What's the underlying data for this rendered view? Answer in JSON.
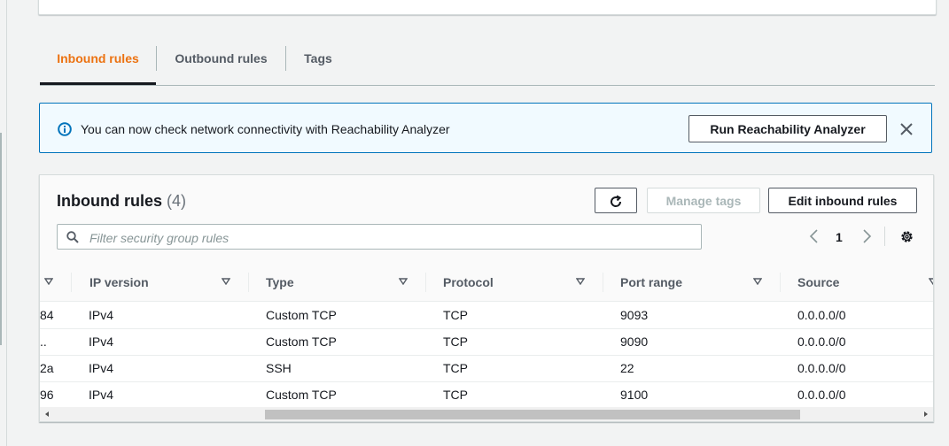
{
  "tabs": [
    {
      "label": "Inbound rules",
      "active": true
    },
    {
      "label": "Outbound rules",
      "active": false
    },
    {
      "label": "Tags",
      "active": false
    }
  ],
  "alert": {
    "icon": "info-icon",
    "message": "You can now check network connectivity with Reachability Analyzer",
    "button_label": "Run Reachability Analyzer",
    "close_icon": "close-icon"
  },
  "panel": {
    "title": "Inbound rules",
    "count": "(4)",
    "refresh_icon": "refresh-icon",
    "manage_tags_label": "Manage tags",
    "edit_label": "Edit inbound rules",
    "filter_placeholder": "Filter security group rules",
    "page_number": "1"
  },
  "table": {
    "columns": [
      "IP version",
      "Type",
      "Protocol",
      "Port range",
      "Source"
    ],
    "rows": [
      {
        "id_tail": "84",
        "ip_version": "IPv4",
        "type": "Custom TCP",
        "protocol": "TCP",
        "port_range": "9093",
        "source": "0.0.0.0/0"
      },
      {
        "id_tail": "..",
        "ip_version": "IPv4",
        "type": "Custom TCP",
        "protocol": "TCP",
        "port_range": "9090",
        "source": "0.0.0.0/0"
      },
      {
        "id_tail": "2a",
        "ip_version": "IPv4",
        "type": "SSH",
        "protocol": "TCP",
        "port_range": "22",
        "source": "0.0.0.0/0"
      },
      {
        "id_tail": "96",
        "ip_version": "IPv4",
        "type": "Custom TCP",
        "protocol": "TCP",
        "port_range": "9100",
        "source": "0.0.0.0/0"
      }
    ]
  },
  "colors": {
    "accent": "#ec7211",
    "info_border": "#0073bb",
    "info_bg": "#f1faff"
  }
}
